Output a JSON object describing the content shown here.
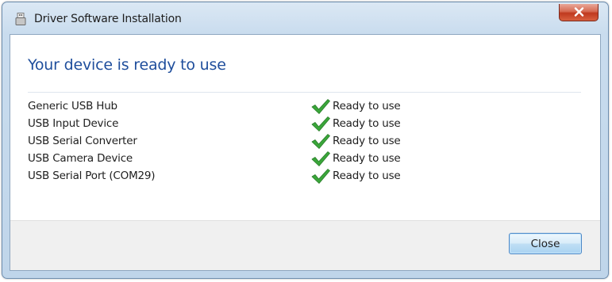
{
  "window": {
    "title": "Driver Software Installation"
  },
  "main": {
    "heading": "Your device is ready to use",
    "devices": [
      {
        "name": "Generic USB Hub",
        "status": "Ready to use"
      },
      {
        "name": "USB Input Device",
        "status": "Ready to use"
      },
      {
        "name": "USB Serial Converter",
        "status": "Ready to use"
      },
      {
        "name": "USB Camera Device",
        "status": "Ready to use"
      },
      {
        "name": "USB Serial Port (COM29)",
        "status": "Ready to use"
      }
    ]
  },
  "footer": {
    "close_label": "Close"
  },
  "icons": {
    "window_icon": "usb-device-icon",
    "status_icon": "checkmark-icon",
    "close_icon": "close-icon"
  },
  "colors": {
    "heading": "#1f4e9c",
    "checkmark": "#3aa63a",
    "close_button_red": "#c0391f"
  }
}
